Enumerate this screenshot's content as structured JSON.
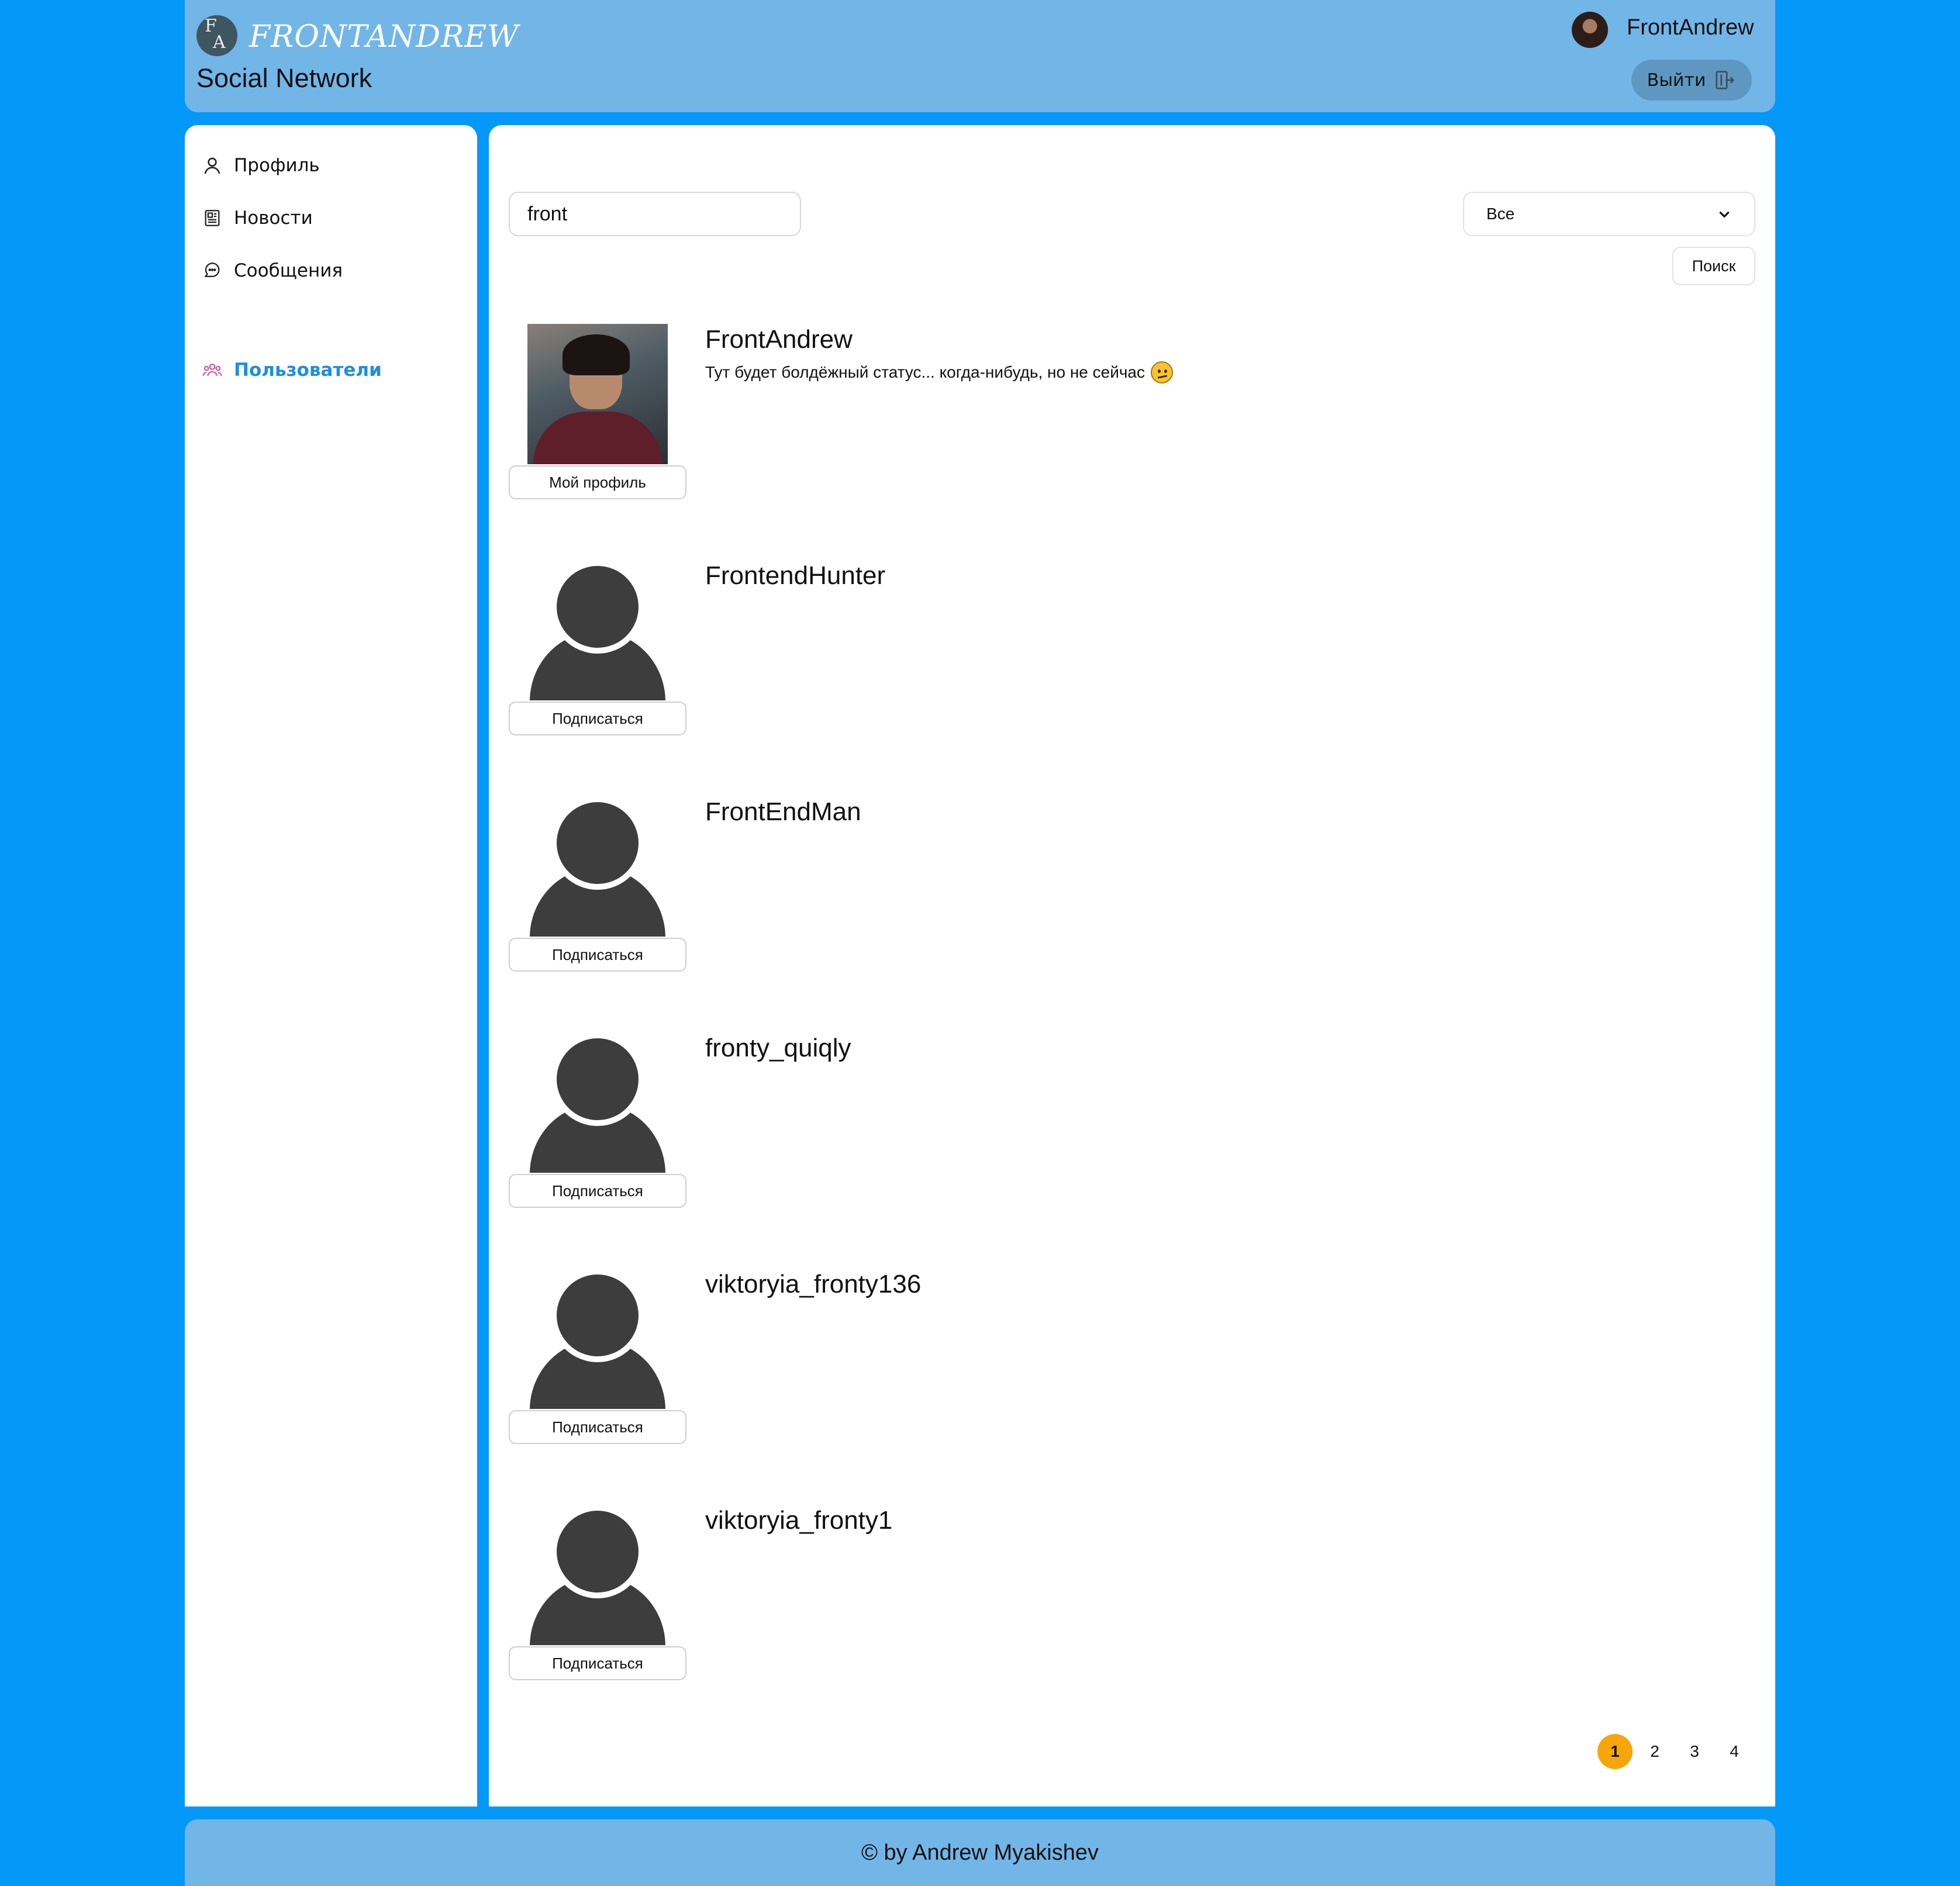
{
  "header": {
    "logo_mark_letters": "FA",
    "logo_text": "FRONTANDREW",
    "subtitle": "Social Network",
    "user_name": "FrontAndrew",
    "logout_label": "Выйти"
  },
  "sidebar": {
    "items": [
      {
        "label": "Профиль",
        "icon": "user-icon"
      },
      {
        "label": "Новости",
        "icon": "news-icon"
      },
      {
        "label": "Сообщения",
        "icon": "chat-icon"
      },
      {
        "label": "Пользователи",
        "icon": "users-icon",
        "active": true
      }
    ]
  },
  "search": {
    "query": "front",
    "filter_selected": "Все",
    "button_label": "Поиск"
  },
  "users": [
    {
      "nick": "FrontAndrew",
      "status": "Тут будет болдёжный статус... когда-нибудь, но не сейчас",
      "button": "Мой профиль",
      "photo": true
    },
    {
      "nick": "FrontendHunter",
      "status": "",
      "button": "Подписаться",
      "photo": false
    },
    {
      "nick": "FrontEndMan",
      "status": "",
      "button": "Подписаться",
      "photo": false
    },
    {
      "nick": "fronty_quiqly",
      "status": "",
      "button": "Подписаться",
      "photo": false
    },
    {
      "nick": "viktoryia_fronty136",
      "status": "",
      "button": "Подписаться",
      "photo": false
    },
    {
      "nick": "viktoryia_fronty1",
      "status": "",
      "button": "Подписаться",
      "photo": false
    }
  ],
  "pagination": {
    "pages": [
      "1",
      "2",
      "3",
      "4"
    ],
    "current": "1"
  },
  "footer": {
    "text": "© by Andrew Myakishev"
  },
  "colors": {
    "background": "#0498f8",
    "header": "#72b6e8",
    "active_nav": "#1f8de0",
    "current_page": "#f6a50b"
  }
}
